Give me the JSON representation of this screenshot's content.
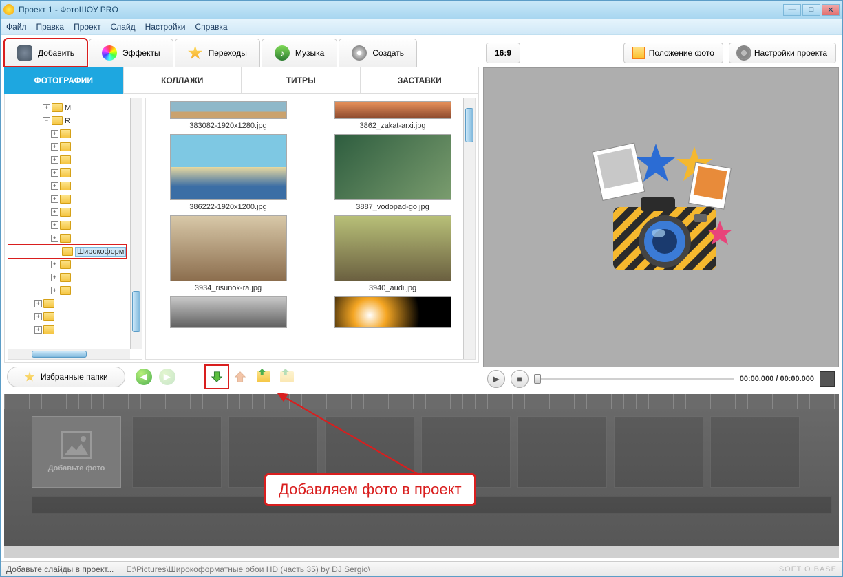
{
  "titlebar": {
    "title": "Проект 1 - ФотоШОУ PRO"
  },
  "menu": {
    "items": [
      "Файл",
      "Правка",
      "Проект",
      "Слайд",
      "Настройки",
      "Справка"
    ]
  },
  "maintabs": {
    "items": [
      "Добавить",
      "Эффекты",
      "Переходы",
      "Музыка",
      "Создать"
    ]
  },
  "subtabs": {
    "items": [
      "ФОТОГРАФИИ",
      "КОЛЛАЖИ",
      "ТИТРЫ",
      "ЗАСТАВКИ"
    ]
  },
  "tree": {
    "selected_label": "Широкоформ"
  },
  "thumbs": {
    "items": [
      {
        "label": "383082-1920x1280.jpg"
      },
      {
        "label": "3862_zakat-arxi.jpg"
      },
      {
        "label": "386222-1920x1200.jpg"
      },
      {
        "label": "3887_vodopad-go.jpg"
      },
      {
        "label": "3934_risunok-ra.jpg"
      },
      {
        "label": "3940_audi.jpg"
      }
    ]
  },
  "fav_button": "Избранные папки",
  "aspect": "16:9",
  "right_buttons": {
    "pos": "Положение фото",
    "settings": "Настройки проекта"
  },
  "player": {
    "time": "00:00.000 / 00:00.000"
  },
  "timeline": {
    "placeholder": "Добавьте фото"
  },
  "statusbar": {
    "hint": "Добавьте слайды в проект...",
    "path": "E:\\Pictures\\Широкоформатные обои HD (часть 35) by DJ Sergio\\",
    "logo": "SOFT O BASE"
  },
  "callout": "Добавляем фото в проект"
}
